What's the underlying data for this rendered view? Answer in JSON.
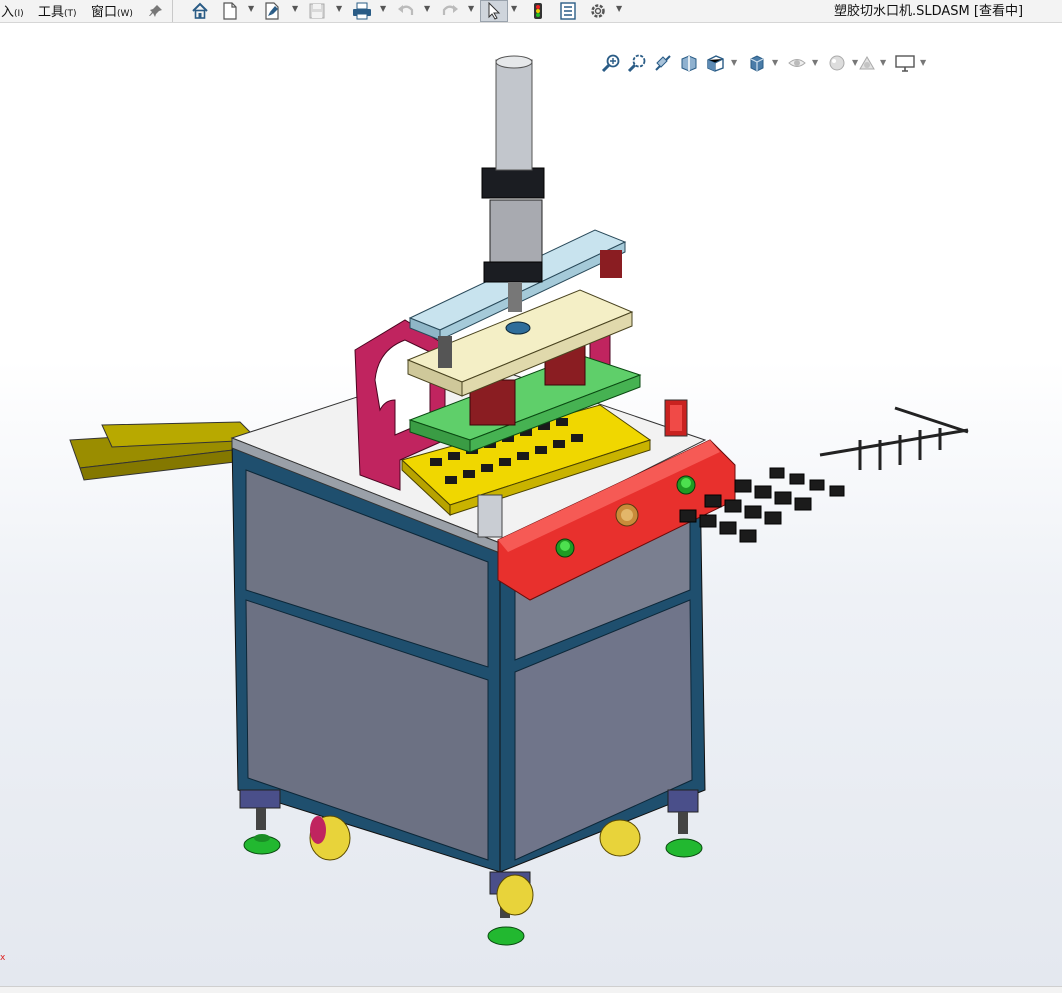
{
  "menu": {
    "insert": {
      "label": "入",
      "accel": "(I)"
    },
    "tools": {
      "label": "工具",
      "accel": "(T)"
    },
    "window": {
      "label": "窗口",
      "accel": "(W)"
    }
  },
  "document_title": "塑胶切水口机.SLDASM [查看中]",
  "toolbar_icons": [
    "pin-icon",
    "home-icon",
    "new-file-icon",
    "open-file-icon",
    "save-icon",
    "print-icon",
    "undo-icon",
    "redo-icon",
    "select-arrow-icon",
    "rebuild-light-icon",
    "file-properties-icon",
    "options-gear-icon"
  ],
  "view_toolbar_icons": [
    "zoom-to-fit-icon",
    "zoom-to-area-icon",
    "previous-view-icon",
    "section-view-icon",
    "view-orientation-icon",
    "display-style-icon",
    "hide-show-items-icon",
    "edit-appearance-icon",
    "apply-scene-icon",
    "view-settings-icon"
  ],
  "triad_label": "x",
  "colors": {
    "frame": "#1f4f6e",
    "panel": "#6e7384",
    "control_box": "#e8302d",
    "clamp": "#c0245f",
    "fixture": "#f0d700",
    "plate": "#f4efc6",
    "die_plate": "#5fcf6a",
    "top_bar": "#c8e3ee",
    "tray": "#a89b00",
    "feet": "#22b830",
    "wheels": "#e8d33a"
  }
}
